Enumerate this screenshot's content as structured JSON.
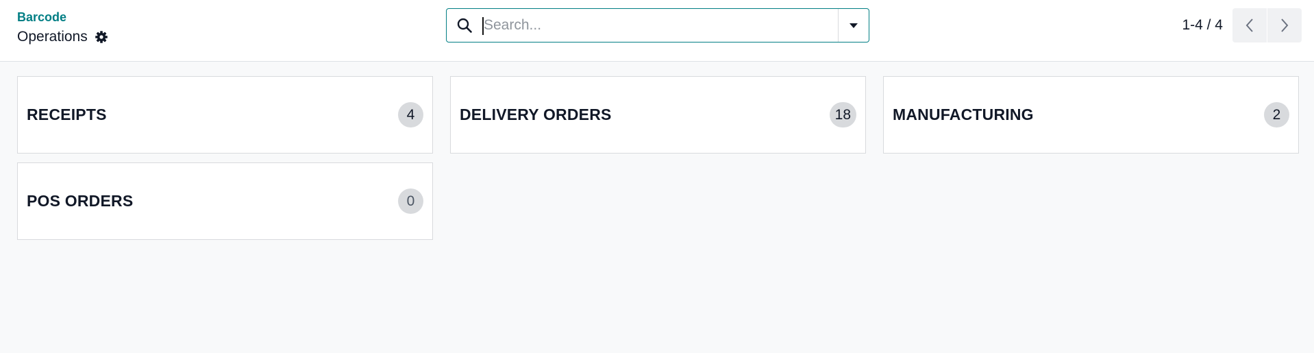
{
  "breadcrumb": {
    "parent": "Barcode",
    "current": "Operations"
  },
  "search": {
    "placeholder": "Search...",
    "value": ""
  },
  "pager": {
    "value": "1-4 / 4"
  },
  "cards": [
    {
      "title": "RECEIPTS",
      "count": "4"
    },
    {
      "title": "DELIVERY ORDERS",
      "count": "18"
    },
    {
      "title": "MANUFACTURING",
      "count": "2"
    },
    {
      "title": "POS ORDERS",
      "count": "0"
    }
  ],
  "colors": {
    "accent": "#017e84",
    "badge_bg": "#d8dadd",
    "page_bg": "#f8f9fa"
  },
  "icons": [
    "gear-icon",
    "search-icon",
    "caret-down-icon",
    "chevron-left-icon",
    "chevron-right-icon"
  ]
}
